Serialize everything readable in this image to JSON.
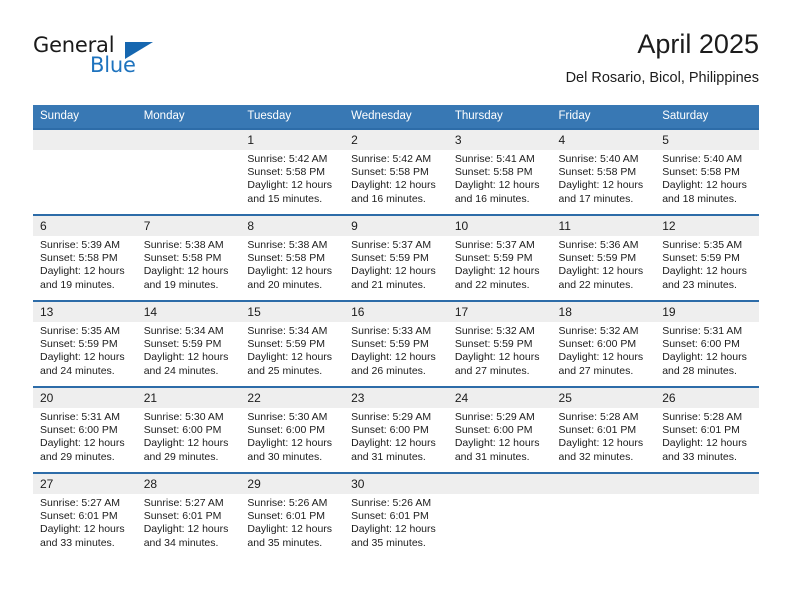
{
  "brand": {
    "line1": "General",
    "line2": "Blue",
    "triangle_color": "#1667b0"
  },
  "header": {
    "title": "April 2025",
    "subtitle": "Del Rosario, Bicol, Philippines"
  },
  "theme": {
    "header_bg": "#3878b4",
    "rule_color": "#2d6ca8",
    "daynum_bg": "#eeeeee",
    "text": "#1c1c1c",
    "brand_blue": "#1e73be"
  },
  "weekday_headers": [
    "Sunday",
    "Monday",
    "Tuesday",
    "Wednesday",
    "Thursday",
    "Friday",
    "Saturday"
  ],
  "weeks": [
    [
      {
        "day": "",
        "sunrise": "",
        "sunset": "",
        "daylight1": "",
        "daylight2": ""
      },
      {
        "day": "",
        "sunrise": "",
        "sunset": "",
        "daylight1": "",
        "daylight2": ""
      },
      {
        "day": "1",
        "sunrise": "Sunrise: 5:42 AM",
        "sunset": "Sunset: 5:58 PM",
        "daylight1": "Daylight: 12 hours",
        "daylight2": "and 15 minutes."
      },
      {
        "day": "2",
        "sunrise": "Sunrise: 5:42 AM",
        "sunset": "Sunset: 5:58 PM",
        "daylight1": "Daylight: 12 hours",
        "daylight2": "and 16 minutes."
      },
      {
        "day": "3",
        "sunrise": "Sunrise: 5:41 AM",
        "sunset": "Sunset: 5:58 PM",
        "daylight1": "Daylight: 12 hours",
        "daylight2": "and 16 minutes."
      },
      {
        "day": "4",
        "sunrise": "Sunrise: 5:40 AM",
        "sunset": "Sunset: 5:58 PM",
        "daylight1": "Daylight: 12 hours",
        "daylight2": "and 17 minutes."
      },
      {
        "day": "5",
        "sunrise": "Sunrise: 5:40 AM",
        "sunset": "Sunset: 5:58 PM",
        "daylight1": "Daylight: 12 hours",
        "daylight2": "and 18 minutes."
      }
    ],
    [
      {
        "day": "6",
        "sunrise": "Sunrise: 5:39 AM",
        "sunset": "Sunset: 5:58 PM",
        "daylight1": "Daylight: 12 hours",
        "daylight2": "and 19 minutes."
      },
      {
        "day": "7",
        "sunrise": "Sunrise: 5:38 AM",
        "sunset": "Sunset: 5:58 PM",
        "daylight1": "Daylight: 12 hours",
        "daylight2": "and 19 minutes."
      },
      {
        "day": "8",
        "sunrise": "Sunrise: 5:38 AM",
        "sunset": "Sunset: 5:58 PM",
        "daylight1": "Daylight: 12 hours",
        "daylight2": "and 20 minutes."
      },
      {
        "day": "9",
        "sunrise": "Sunrise: 5:37 AM",
        "sunset": "Sunset: 5:59 PM",
        "daylight1": "Daylight: 12 hours",
        "daylight2": "and 21 minutes."
      },
      {
        "day": "10",
        "sunrise": "Sunrise: 5:37 AM",
        "sunset": "Sunset: 5:59 PM",
        "daylight1": "Daylight: 12 hours",
        "daylight2": "and 22 minutes."
      },
      {
        "day": "11",
        "sunrise": "Sunrise: 5:36 AM",
        "sunset": "Sunset: 5:59 PM",
        "daylight1": "Daylight: 12 hours",
        "daylight2": "and 22 minutes."
      },
      {
        "day": "12",
        "sunrise": "Sunrise: 5:35 AM",
        "sunset": "Sunset: 5:59 PM",
        "daylight1": "Daylight: 12 hours",
        "daylight2": "and 23 minutes."
      }
    ],
    [
      {
        "day": "13",
        "sunrise": "Sunrise: 5:35 AM",
        "sunset": "Sunset: 5:59 PM",
        "daylight1": "Daylight: 12 hours",
        "daylight2": "and 24 minutes."
      },
      {
        "day": "14",
        "sunrise": "Sunrise: 5:34 AM",
        "sunset": "Sunset: 5:59 PM",
        "daylight1": "Daylight: 12 hours",
        "daylight2": "and 24 minutes."
      },
      {
        "day": "15",
        "sunrise": "Sunrise: 5:34 AM",
        "sunset": "Sunset: 5:59 PM",
        "daylight1": "Daylight: 12 hours",
        "daylight2": "and 25 minutes."
      },
      {
        "day": "16",
        "sunrise": "Sunrise: 5:33 AM",
        "sunset": "Sunset: 5:59 PM",
        "daylight1": "Daylight: 12 hours",
        "daylight2": "and 26 minutes."
      },
      {
        "day": "17",
        "sunrise": "Sunrise: 5:32 AM",
        "sunset": "Sunset: 5:59 PM",
        "daylight1": "Daylight: 12 hours",
        "daylight2": "and 27 minutes."
      },
      {
        "day": "18",
        "sunrise": "Sunrise: 5:32 AM",
        "sunset": "Sunset: 6:00 PM",
        "daylight1": "Daylight: 12 hours",
        "daylight2": "and 27 minutes."
      },
      {
        "day": "19",
        "sunrise": "Sunrise: 5:31 AM",
        "sunset": "Sunset: 6:00 PM",
        "daylight1": "Daylight: 12 hours",
        "daylight2": "and 28 minutes."
      }
    ],
    [
      {
        "day": "20",
        "sunrise": "Sunrise: 5:31 AM",
        "sunset": "Sunset: 6:00 PM",
        "daylight1": "Daylight: 12 hours",
        "daylight2": "and 29 minutes."
      },
      {
        "day": "21",
        "sunrise": "Sunrise: 5:30 AM",
        "sunset": "Sunset: 6:00 PM",
        "daylight1": "Daylight: 12 hours",
        "daylight2": "and 29 minutes."
      },
      {
        "day": "22",
        "sunrise": "Sunrise: 5:30 AM",
        "sunset": "Sunset: 6:00 PM",
        "daylight1": "Daylight: 12 hours",
        "daylight2": "and 30 minutes."
      },
      {
        "day": "23",
        "sunrise": "Sunrise: 5:29 AM",
        "sunset": "Sunset: 6:00 PM",
        "daylight1": "Daylight: 12 hours",
        "daylight2": "and 31 minutes."
      },
      {
        "day": "24",
        "sunrise": "Sunrise: 5:29 AM",
        "sunset": "Sunset: 6:00 PM",
        "daylight1": "Daylight: 12 hours",
        "daylight2": "and 31 minutes."
      },
      {
        "day": "25",
        "sunrise": "Sunrise: 5:28 AM",
        "sunset": "Sunset: 6:01 PM",
        "daylight1": "Daylight: 12 hours",
        "daylight2": "and 32 minutes."
      },
      {
        "day": "26",
        "sunrise": "Sunrise: 5:28 AM",
        "sunset": "Sunset: 6:01 PM",
        "daylight1": "Daylight: 12 hours",
        "daylight2": "and 33 minutes."
      }
    ],
    [
      {
        "day": "27",
        "sunrise": "Sunrise: 5:27 AM",
        "sunset": "Sunset: 6:01 PM",
        "daylight1": "Daylight: 12 hours",
        "daylight2": "and 33 minutes."
      },
      {
        "day": "28",
        "sunrise": "Sunrise: 5:27 AM",
        "sunset": "Sunset: 6:01 PM",
        "daylight1": "Daylight: 12 hours",
        "daylight2": "and 34 minutes."
      },
      {
        "day": "29",
        "sunrise": "Sunrise: 5:26 AM",
        "sunset": "Sunset: 6:01 PM",
        "daylight1": "Daylight: 12 hours",
        "daylight2": "and 35 minutes."
      },
      {
        "day": "30",
        "sunrise": "Sunrise: 5:26 AM",
        "sunset": "Sunset: 6:01 PM",
        "daylight1": "Daylight: 12 hours",
        "daylight2": "and 35 minutes."
      },
      {
        "day": "",
        "sunrise": "",
        "sunset": "",
        "daylight1": "",
        "daylight2": ""
      },
      {
        "day": "",
        "sunrise": "",
        "sunset": "",
        "daylight1": "",
        "daylight2": ""
      },
      {
        "day": "",
        "sunrise": "",
        "sunset": "",
        "daylight1": "",
        "daylight2": ""
      }
    ]
  ]
}
